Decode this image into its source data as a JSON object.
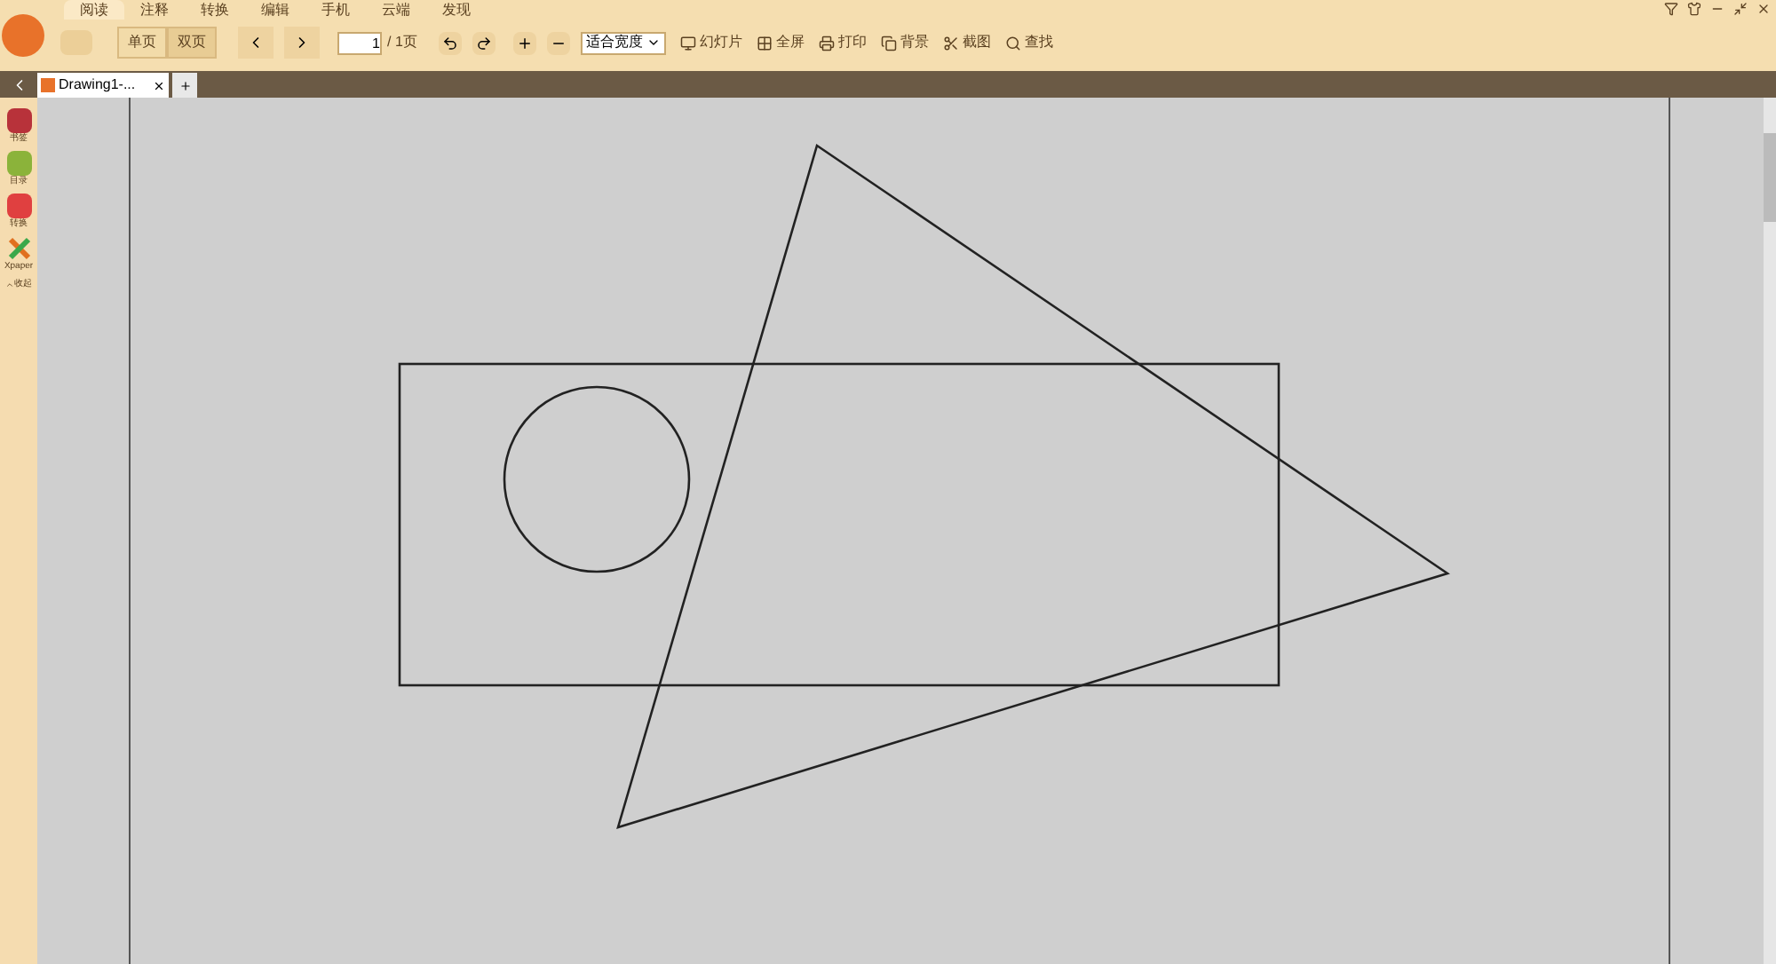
{
  "menu": [
    {
      "label": "阅读",
      "selected": true
    },
    {
      "label": "注释",
      "selected": false
    },
    {
      "label": "转换",
      "selected": false
    },
    {
      "label": "编辑",
      "selected": false
    },
    {
      "label": "手机",
      "selected": false
    },
    {
      "label": "云端",
      "selected": false
    },
    {
      "label": "发现",
      "selected": false
    }
  ],
  "view_modes": [
    {
      "label": "单页",
      "selected": false
    },
    {
      "label": "双页",
      "selected": true
    }
  ],
  "page": {
    "value": "1",
    "total": "/ 1页"
  },
  "zoom_select": {
    "value": "适合宽度"
  },
  "tools": [
    {
      "kind": "slideshow",
      "label": "幻灯片"
    },
    {
      "kind": "fullscreen",
      "label": "全屏"
    },
    {
      "kind": "print",
      "label": "打印"
    },
    {
      "kind": "background",
      "label": "背景"
    },
    {
      "kind": "screenshot",
      "label": "截图"
    },
    {
      "kind": "search",
      "label": "查找"
    }
  ],
  "doc_tabs": [
    {
      "title": "Drawing1-...",
      "selected": true
    }
  ],
  "sidebar": {
    "items": [
      {
        "kind": "bookmark",
        "label": "书签"
      },
      {
        "kind": "toc",
        "label": "目录"
      },
      {
        "kind": "convert",
        "label": "转换"
      },
      {
        "kind": "xpaper",
        "label": "Xpaper"
      }
    ],
    "collapse": "收起"
  }
}
